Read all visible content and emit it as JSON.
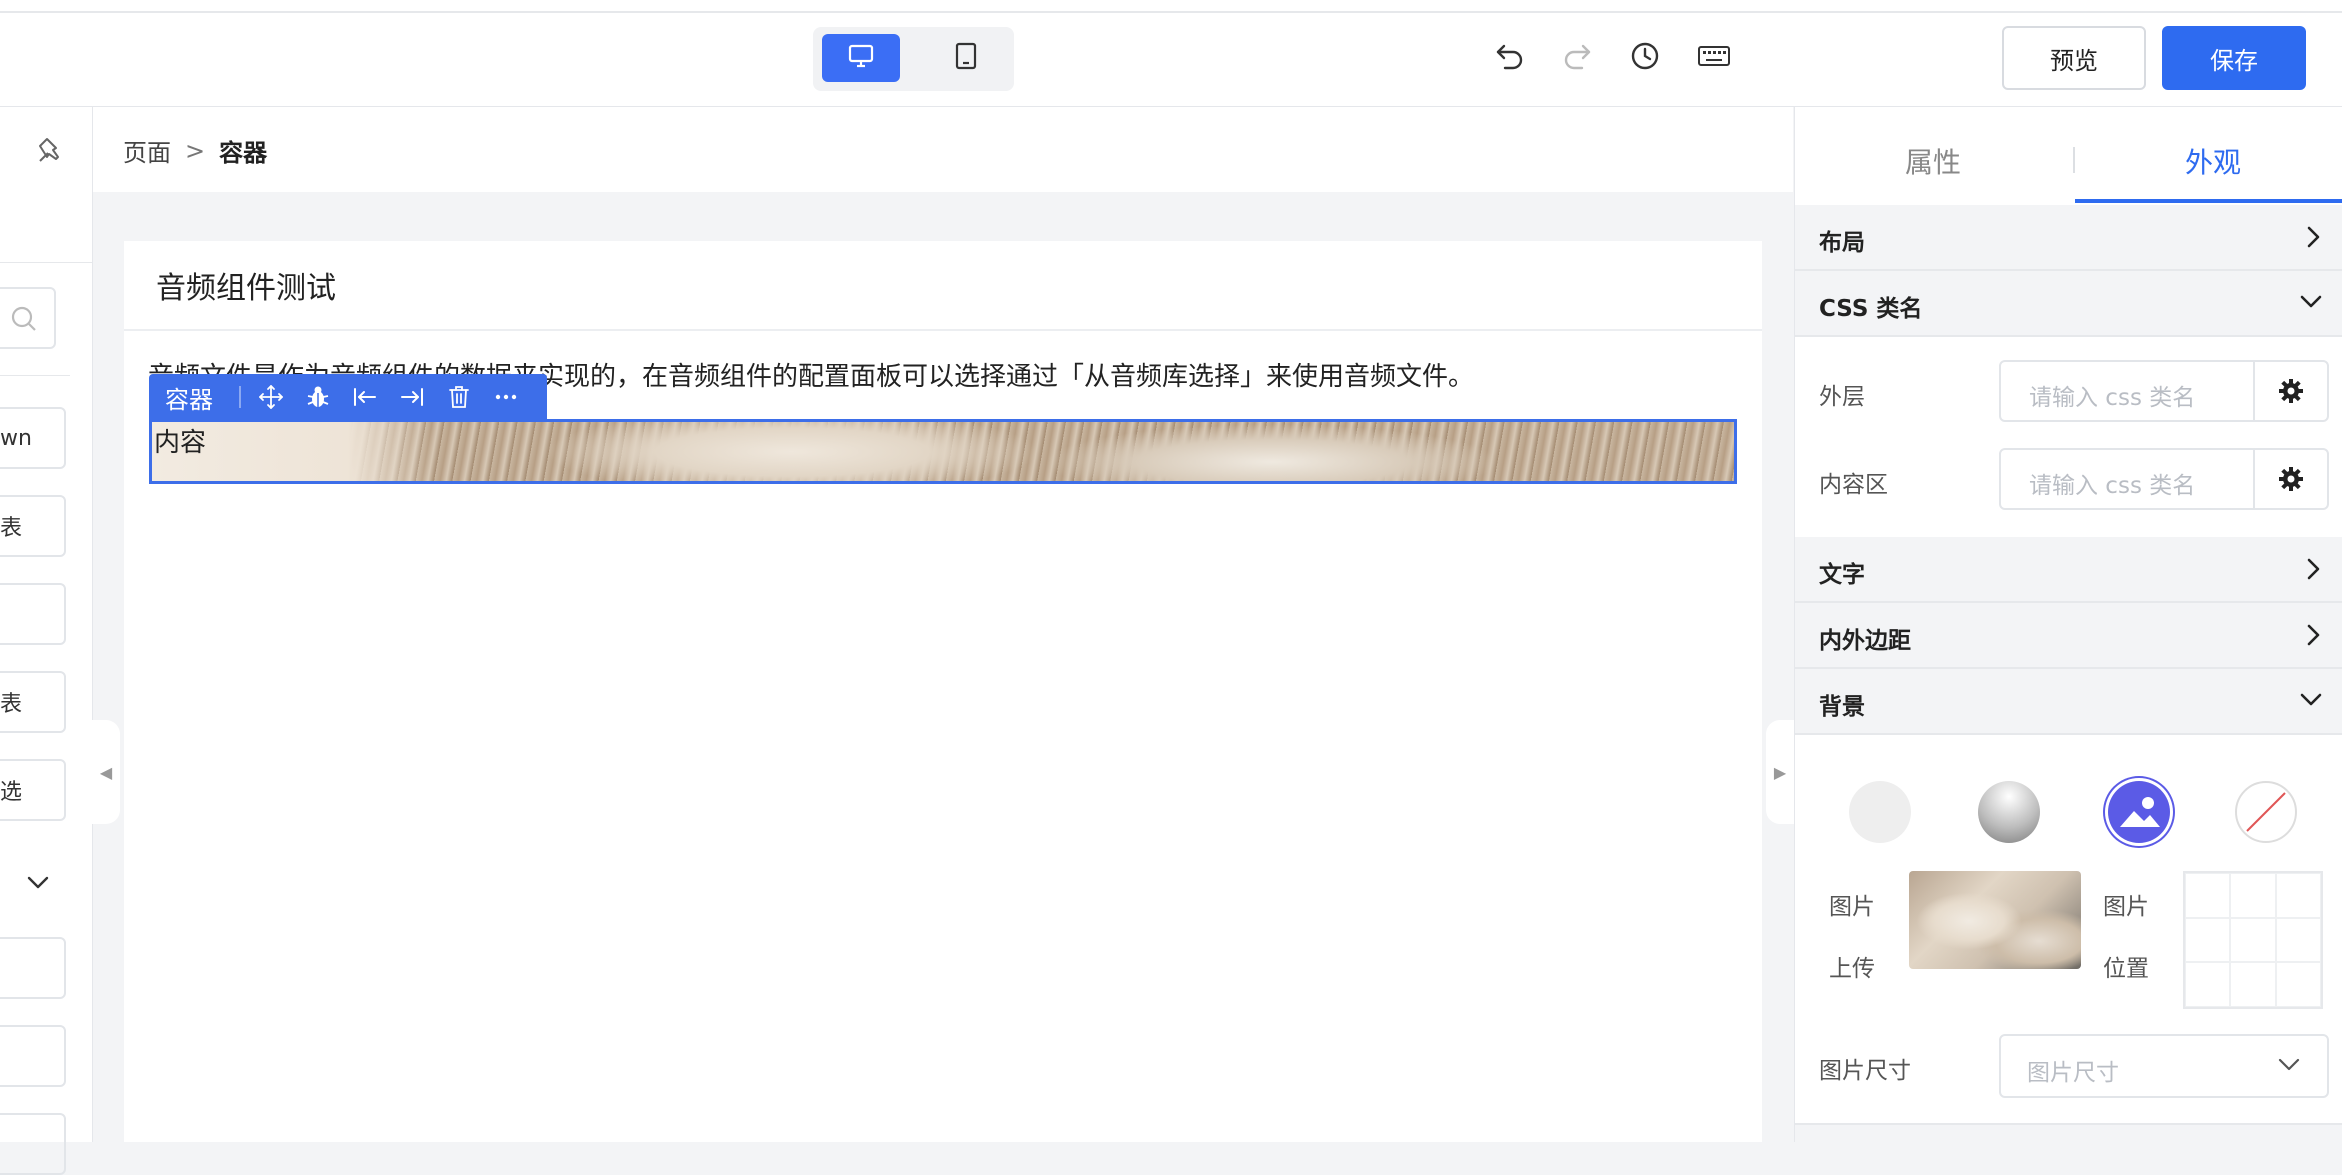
{
  "toolbar": {
    "device_modes": [
      "desktop-icon",
      "tablet-icon"
    ],
    "active_device": "desktop",
    "tools": [
      "undo-icon",
      "redo-icon",
      "history-icon",
      "keyboard-icon"
    ],
    "preview_label": "预览",
    "save_label": "保存"
  },
  "left_panel": {
    "pin_icon": "pin-icon",
    "items": [
      "wn",
      "表",
      "",
      "表",
      "选",
      "",
      "",
      ""
    ]
  },
  "breadcrumb": {
    "root": "页面",
    "separator": ">",
    "current": "容器"
  },
  "canvas": {
    "card_title": "音频组件测试",
    "description": "音频文件是作为音频组件的数据来实现的，在音频组件的配置面板可以选择通过「从音频库选择」来使用音频文件。",
    "selection_toolbar": {
      "label": "容器",
      "icons": [
        "move-icon",
        "bug-icon",
        "align-left-icon",
        "align-right-icon",
        "delete-icon",
        "more-icon"
      ]
    },
    "container_text": "内容"
  },
  "right_panel": {
    "tabs": [
      "属性",
      "外观"
    ],
    "active_tab": "外观",
    "sections": {
      "layout": "布局",
      "css_class": "CSS 类名",
      "text": "文字",
      "spacing": "内外边距",
      "background": "背景"
    },
    "css_fields": [
      {
        "label": "外层",
        "placeholder": "请输入 css 类名"
      },
      {
        "label": "内容区",
        "placeholder": "请输入 css 类名"
      }
    ],
    "background": {
      "types": [
        "solid-color-icon",
        "gradient-icon",
        "image-icon",
        "none-icon"
      ],
      "active_type": "image",
      "image_upload_label_1": "图片",
      "image_upload_label_2": "上传",
      "image_position_label_1": "图片",
      "image_position_label_2": "位置",
      "image_size_label": "图片尺寸",
      "image_size_placeholder": "图片尺寸"
    }
  },
  "colors": {
    "primary": "#2e6bf0",
    "selection": "#3d6ee9",
    "image_type_active": "#5b5be6"
  }
}
